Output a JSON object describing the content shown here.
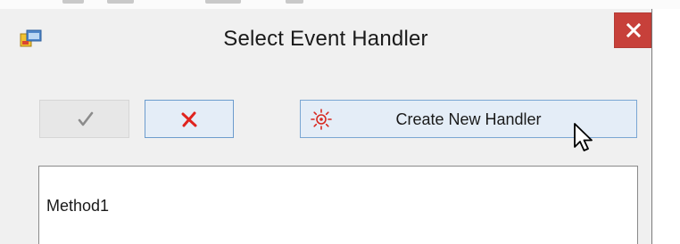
{
  "window": {
    "title": "Select Event Handler"
  },
  "icons": {
    "app": "application-icon",
    "close": "close-icon",
    "ok": "checkmark-icon",
    "cancel": "red-x-icon",
    "create": "sun-burst-icon",
    "cursor": "mouse-pointer-icon"
  },
  "toolbar": {
    "create_label": "Create New Handler"
  },
  "handlers": {
    "items": [
      "Method1"
    ]
  },
  "colors": {
    "close_button": "#c7403a",
    "button_highlight": "#e4edf7",
    "button_border": "#7aa6d3",
    "cancel_x": "#e0231e",
    "create_icon": "#d8281f"
  }
}
